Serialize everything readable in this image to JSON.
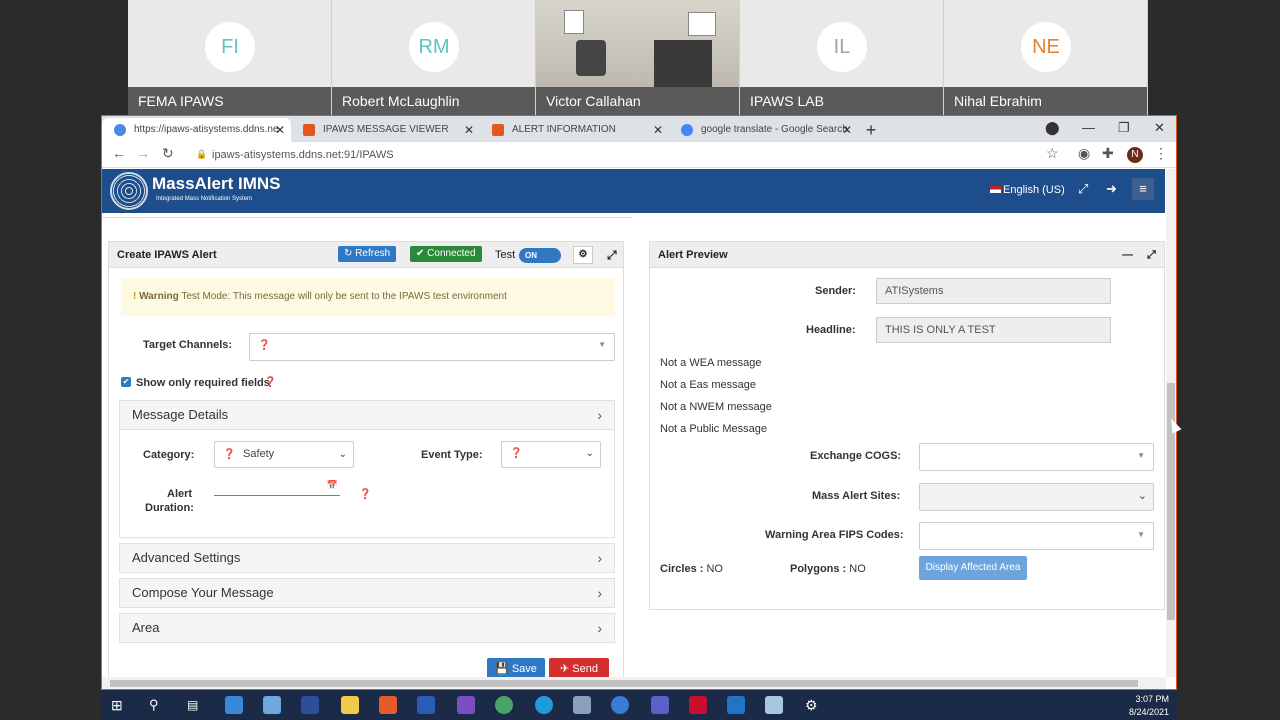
{
  "video": {
    "participants": [
      {
        "initials": "FI",
        "name": "FEMA IPAWS",
        "color": "#5fc3c4"
      },
      {
        "initials": "RM",
        "name": "Robert McLaughlin",
        "color": "#5fc3c4"
      },
      {
        "initials": "",
        "name": "Victor Callahan",
        "color": ""
      },
      {
        "initials": "IL",
        "name": "IPAWS LAB",
        "color": "#9aa4ad"
      },
      {
        "initials": "NE",
        "name": "Nihal Ebrahim",
        "color": "#e3822e"
      }
    ]
  },
  "browser": {
    "tabs": [
      {
        "label": "https://ipaws-atisystems.ddns.ne",
        "fav": "#4a8ae0"
      },
      {
        "label": "IPAWS MESSAGE VIEWER",
        "fav": "#e2571e"
      },
      {
        "label": "ALERT INFORMATION",
        "fav": "#e2571e"
      },
      {
        "label": "google translate - Google Search",
        "fav": "#4285f4"
      }
    ],
    "url": "ipaws-atisystems.ddns.net:91/IPAWS",
    "profile_initial": "N"
  },
  "header": {
    "brand": "MassAlert IMNS",
    "brand_sub": "Integrated Mass Notification System",
    "language": "English (US)"
  },
  "create": {
    "title": "Create IPAWS Alert",
    "refresh": "Refresh",
    "connected": "Connected",
    "test_label": "Test",
    "toggle": "ON",
    "warning_bold": "Warning",
    "warning_text": "Test Mode: This message will only be sent to the IPAWS test environment",
    "target_channels": "Target Channels:",
    "show_required": "Show only required fields",
    "message_details": "Message Details",
    "category_label": "Category:",
    "category_value": "Safety",
    "event_type_label": "Event Type:",
    "alert_label": "Alert",
    "duration_label": "Duration:",
    "advanced": "Advanced Settings",
    "compose": "Compose Your Message",
    "area": "Area",
    "save": "Save",
    "send": "Send"
  },
  "preview": {
    "title": "Alert Preview",
    "sender_label": "Sender:",
    "sender_value": "ATISystems",
    "headline_label": "Headline:",
    "headline_value": "THIS IS ONLY A TEST",
    "notes": [
      "Not a WEA message",
      "Not a Eas message",
      "Not a NWEM message",
      "Not a Public Message"
    ],
    "cogs_label": "Exchange COGS:",
    "sites_label": "Mass Alert Sites:",
    "fips_label": "Warning Area FIPS Codes:",
    "circles_label": "Circles :",
    "circles_value": "NO",
    "polygons_label": "Polygons :",
    "polygons_value": "NO",
    "display_btn": "Display Affected Area"
  },
  "taskbar": {
    "time": "3:07 PM",
    "date": "8/24/2021"
  }
}
